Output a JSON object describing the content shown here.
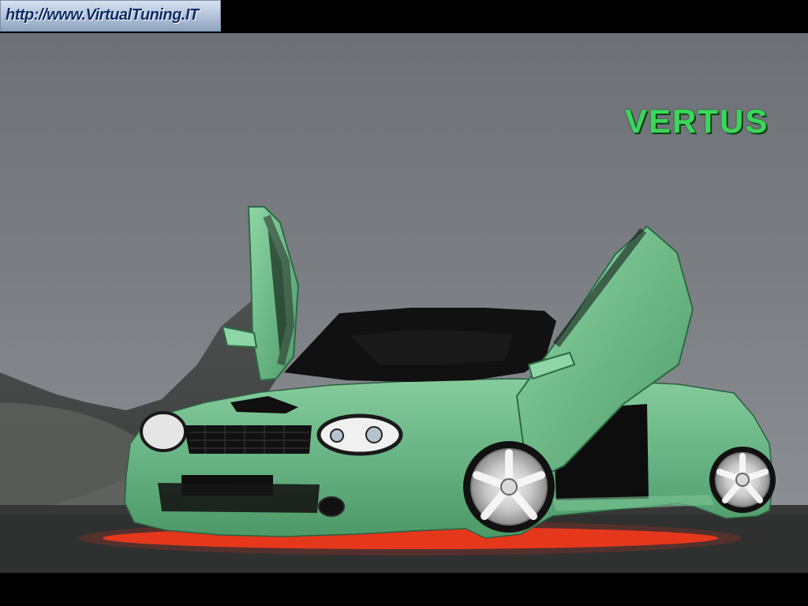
{
  "watermark": {
    "url_text": "http://www.VirtualTuning.IT"
  },
  "brand": {
    "text": "VERTUS",
    "color": "#3cd65a"
  },
  "scene": {
    "subject": "car",
    "car_color": "#67b383",
    "underglow_color": "#ff3a1a"
  }
}
